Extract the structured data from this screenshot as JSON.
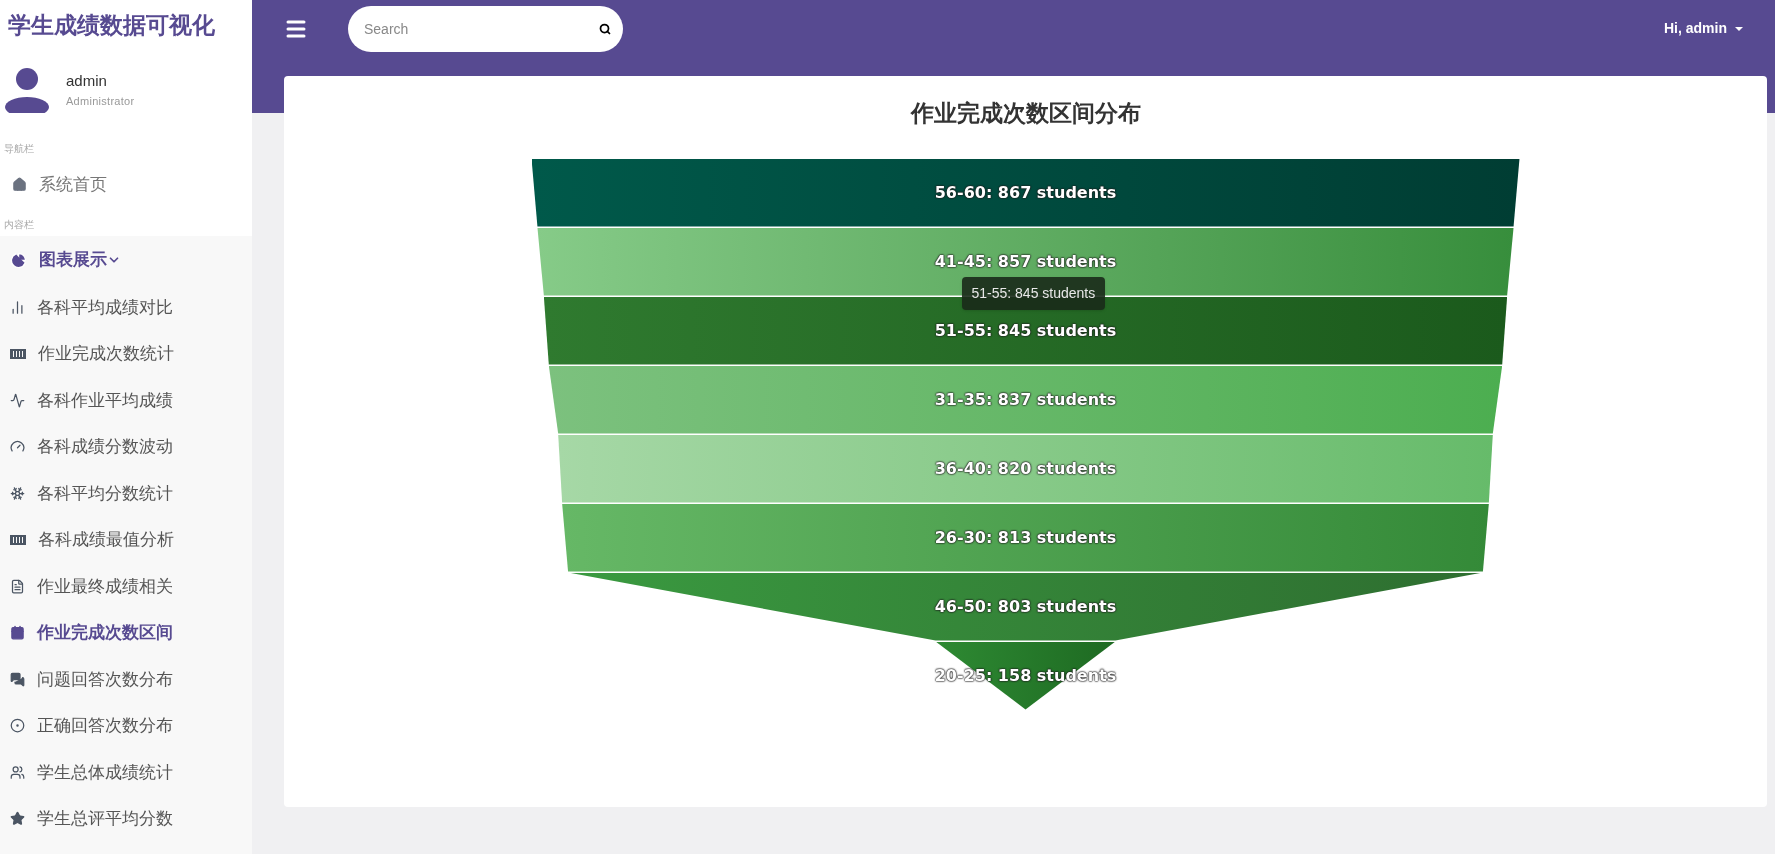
{
  "sidebar": {
    "brand": "学生成绩数据可视化",
    "user": {
      "name": "admin",
      "role": "Administrator"
    },
    "nav_heading": "导航栏",
    "home": {
      "label": "系统首页",
      "selected": false
    },
    "content_heading": "内容栏",
    "group": {
      "label": "图表展示",
      "expanded": true,
      "items": [
        {
          "label": "各科平均成绩对比",
          "selected": false
        },
        {
          "label": "作业完成次数统计",
          "selected": false
        },
        {
          "label": "各科作业平均成绩",
          "selected": false
        },
        {
          "label": "各科成绩分数波动",
          "selected": false
        },
        {
          "label": "各科平均分数统计",
          "selected": false
        },
        {
          "label": "各科成绩最值分析",
          "selected": false
        },
        {
          "label": "作业最终成绩相关",
          "selected": false
        },
        {
          "label": "作业完成次数区间",
          "selected": true
        },
        {
          "label": "问题回答次数分布",
          "selected": false
        },
        {
          "label": "正确回答次数分布",
          "selected": false
        },
        {
          "label": "学生总体成绩统计",
          "selected": false
        },
        {
          "label": "学生总评平均分数",
          "selected": false
        }
      ]
    }
  },
  "header": {
    "search": {
      "placeholder": "Search"
    },
    "greeting": "Hi, admin"
  },
  "card": {
    "title": "作业完成次数区间分布",
    "funnel": [
      {
        "label": "56-60: 867 students"
      },
      {
        "label": "41-45: 857 students"
      },
      {
        "label": "51-55: 845 students"
      },
      {
        "label": "31-35: 837 students"
      },
      {
        "label": "36-40: 820 students"
      },
      {
        "label": "26-30: 813 students"
      },
      {
        "label": "46-50: 803 students"
      },
      {
        "label": "20-25: 158 students"
      }
    ],
    "tooltip": "51-55: 845 students"
  }
}
